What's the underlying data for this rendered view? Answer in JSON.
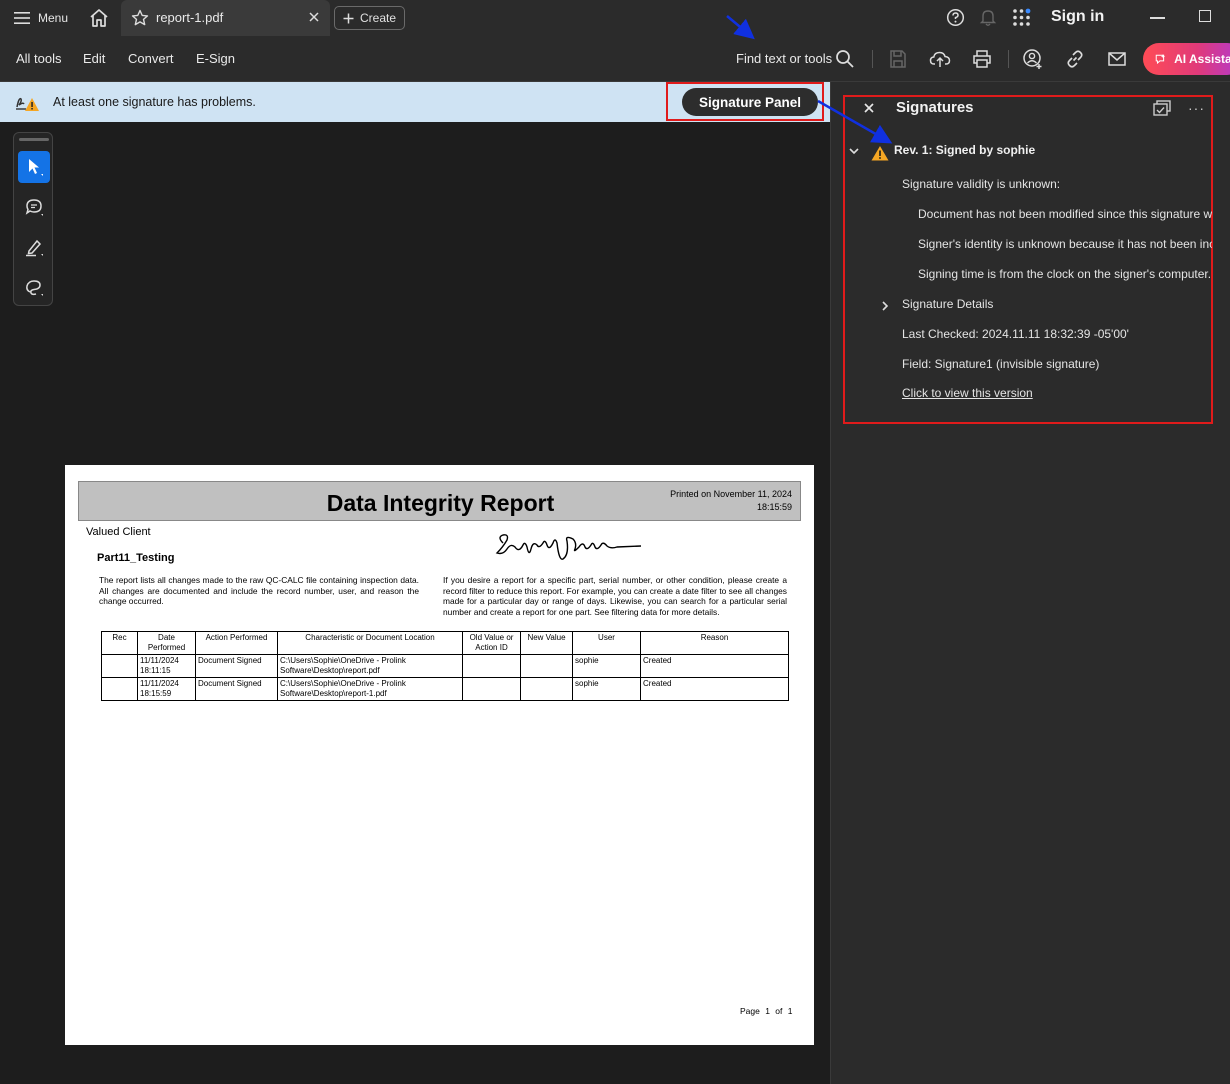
{
  "titlebar": {
    "menu_label": "Menu",
    "tab_name": "report-1.pdf",
    "create_label": "Create",
    "sign_in": "Sign in"
  },
  "toolbar": {
    "items": [
      "All tools",
      "Edit",
      "Convert",
      "E-Sign"
    ],
    "find_label": "Find text or tools",
    "ai_label": "AI Assistant"
  },
  "messagebar": {
    "text": "At least one signature has problems.",
    "button": "Signature Panel"
  },
  "report": {
    "title": "Data Integrity Report",
    "printed_line1": "Printed on November 11, 2024",
    "printed_line2": "18:15:59",
    "client": "Valued Client",
    "section": "Part11_Testing",
    "para_left": "The report lists all changes made to the raw QC-CALC file containing inspection data. All changes are documented and include the record number, user, and reason the change occurred.",
    "para_right": "If you desire a report for a specific part, serial number, or other condition, please create a record filter to reduce this report. For example, you can create a date filter to see all changes made for a particular day or range of days. Likewise, you can search for a particular serial number and create a report for one part. See filtering data for more details.",
    "columns": [
      "Rec",
      "Date Performed",
      "Action Performed",
      "Characteristic or Document Location",
      "Old Value or Action ID",
      "New Value",
      "User",
      "Reason"
    ],
    "rows": [
      {
        "rec": "",
        "date": "11/11/2024 18:11:15",
        "action": "Document Signed",
        "location": "C:\\Users\\Sophie\\OneDrive - Prolink Software\\Desktop\\report.pdf",
        "old": "",
        "new": "",
        "user": "sophie",
        "reason": "Created"
      },
      {
        "rec": "",
        "date": "11/11/2024 18:15:59",
        "action": "Document Signed",
        "location": "C:\\Users\\Sophie\\OneDrive - Prolink Software\\Desktop\\report-1.pdf",
        "old": "",
        "new": "",
        "user": "sophie",
        "reason": "Created"
      }
    ],
    "pager": "Page 1 of 1"
  },
  "signatures_panel": {
    "title": "Signatures",
    "revision": "Rev. 1: Signed by sophie",
    "validity": "Signature validity is unknown:",
    "detail_1": "Document has not been modified since this signature was applied.",
    "detail_2": "Signer's identity is unknown because it has not been included in your list of trusted certificates.",
    "detail_3": "Signing time is from the clock on the signer's computer.",
    "details_label": "Signature Details",
    "last_checked": "Last Checked: 2024.11.11 18:32:39 -05'00'",
    "field": "Field: Signature1 (invisible signature)",
    "view_link": "Click to view this version"
  },
  "colors": {
    "accent": "#1473e6",
    "annotation_red": "#e01b1b",
    "annotation_arrow": "#1030e0",
    "warning": "#f5a623"
  }
}
